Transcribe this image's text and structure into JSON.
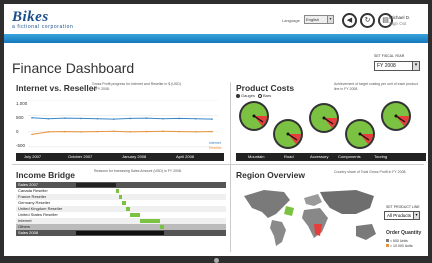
{
  "header": {
    "logo_main": "Bikes",
    "logo_sub": "a fictional corporation",
    "language_label": "Language",
    "language_value": "English",
    "user_name": "Michael D.",
    "sign_out": "Sign Out",
    "icons": [
      "back-icon",
      "refresh-icon",
      "print-icon"
    ]
  },
  "page_title": "Finance Dashboard",
  "fiscal_year": {
    "label": "SET FISCAL YEAR",
    "value": "FY 2008"
  },
  "internet_reseller": {
    "title": "Internet vs. Reseller",
    "note": "Gross Profit progress for Internet and Reseller in $ (USD) in FY 2008.",
    "y_labels": [
      "1.000",
      "500",
      "0",
      "-500"
    ],
    "x_labels": [
      "July 2007",
      "October 2007",
      "January 2008",
      "April 2008"
    ],
    "legend": [
      "Internet",
      "Reseller"
    ]
  },
  "chart_data": {
    "type": "line",
    "x": [
      "Jul",
      "Aug",
      "Sep",
      "Oct",
      "Nov",
      "Dec",
      "Jan",
      "Feb",
      "Mar",
      "Apr",
      "May",
      "Jun"
    ],
    "series": [
      {
        "name": "Internet",
        "values": [
          430,
          400,
          420,
          410,
          400,
          390,
          410,
          420,
          400,
          410,
          400,
          390
        ]
      },
      {
        "name": "Reseller",
        "values": [
          -100,
          -20,
          -10,
          -20,
          -10,
          0,
          -20,
          -10,
          0,
          -10,
          -20,
          -10
        ]
      }
    ],
    "ylim": [
      -600,
      1000
    ],
    "colors": {
      "Internet": "#3a86c8",
      "Reseller": "#e8923a"
    }
  },
  "product_costs": {
    "title": "Product Costs",
    "note": "Achievement of target costing per unit of each product line in FY 2008.",
    "options": [
      "Gauges",
      "Bars"
    ],
    "categories": [
      "Mountain",
      "Road",
      "Accessory",
      "Components",
      "Touring"
    ]
  },
  "income_bridge": {
    "title": "Income Bridge",
    "note": "Reasons for increasing Sales Amount (USD) in FY 2008.",
    "rows": [
      "Sales 2007",
      "Canada Reseller",
      "France Reseller",
      "Germany Reseller",
      "United Kingdom Reseller",
      "United States Reseller",
      "Internet",
      "Others",
      "Sales 2008"
    ]
  },
  "region_overview": {
    "title": "Region Overview",
    "note": "Country share of Total Gross Profit in FY 2008.",
    "product_line_label": "SET PRODUCT LINE",
    "product_line_value": "All Products",
    "order_quantity_label": "Order Quantity",
    "legend": [
      "< 600 Units",
      "> 10 000 Units"
    ]
  },
  "colors": {
    "accent": "#1b79bf",
    "green": "#7cc242",
    "dark": "#222222"
  }
}
